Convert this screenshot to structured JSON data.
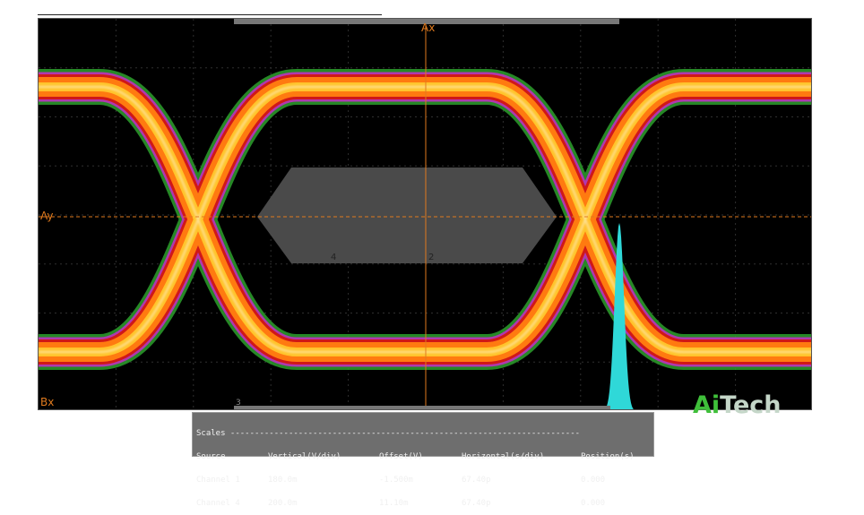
{
  "scope": {
    "markers": {
      "ax": "Ax",
      "ay": "Ay",
      "bx": "Bx",
      "mask_label_left": "4",
      "mask_label_center": "2",
      "bottom_marker": "3"
    },
    "colors": {
      "background": "#000000",
      "grid": "#2f2f2f",
      "cursor": "#e07a1e",
      "mask": "#4a4a4a",
      "histogram": "#2fd8d8",
      "trace_outer": "#2da02d",
      "trace_mid": "#c030c0",
      "trace_inner": "#d01818",
      "trace_body": "#ff7a10",
      "trace_hot": "#ffcc30",
      "trace_peak": "#ffffff"
    }
  },
  "logo": {
    "part1": "Ai",
    "part2": "Tech"
  },
  "scales": {
    "title": "Scales ------------------------------------------------------------------------",
    "headers": [
      "Source",
      "Vertical(V/div)",
      "Offset(V)",
      "Horizontal(s/div)",
      "Position(s)"
    ],
    "rows": [
      [
        "Channel 1",
        "180.0m",
        "-1.500m",
        "67.40p",
        "0.000"
      ],
      [
        "Channel 4",
        "200.0m",
        "11.10m",
        "67.40p",
        "0.000"
      ]
    ]
  }
}
